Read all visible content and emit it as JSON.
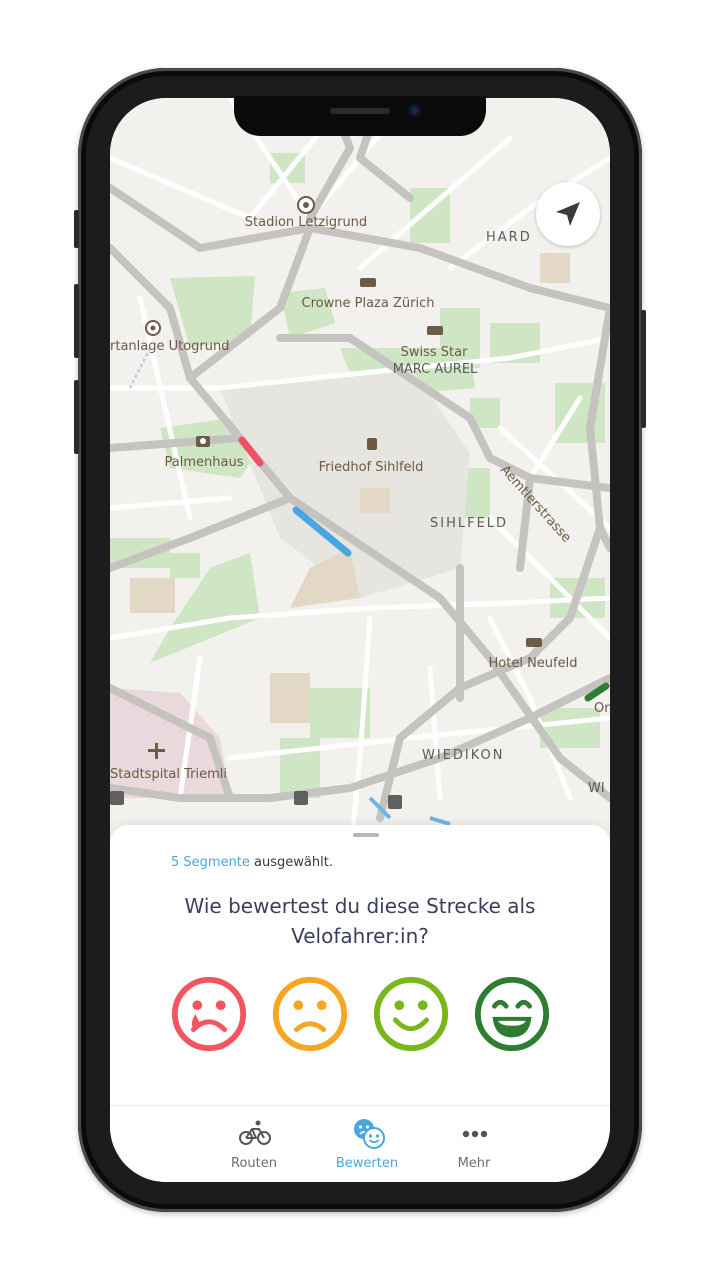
{
  "map": {
    "labels": {
      "stadion": "Stadion Letzigrund",
      "hard": "HARD",
      "crowne": "Crowne Plaza Zürich",
      "sportanlage": "rtanlage Utogrund",
      "swiss_star": "Swiss Star",
      "marc_aurel": "MARC AUREL",
      "palmenhaus": "Palmenhaus",
      "friedhof": "Friedhof Sihlfeld",
      "aemtlerstrasse": "Aemtlerstrasse",
      "sihlfeld": "SIHLFELD",
      "hotel_neufeld": "Hotel Neufeld",
      "wiedikon": "WIEDIKON",
      "stadtspital": "Stadtspital Triemli",
      "edge_or": "Or",
      "edge_wi": "WI"
    },
    "segment_colors": {
      "bad": "#f0505f",
      "selected": "#4aa6e0",
      "good": "#2e7d32"
    }
  },
  "locate_button": {
    "icon": "navigation-arrow-icon"
  },
  "rating_sheet": {
    "selected_count": "5 Segmente",
    "selected_suffix": " ausgewählt.",
    "question_line1": "Wie bewertest du diese Strecke als",
    "question_line2": "Velofahrer:in?",
    "options": [
      {
        "icon": "very-unhappy-face-icon",
        "color": "#f2555f"
      },
      {
        "icon": "unhappy-face-icon",
        "color": "#f5a623"
      },
      {
        "icon": "happy-face-icon",
        "color": "#79b61b"
      },
      {
        "icon": "very-happy-face-icon",
        "color": "#2f7d32"
      }
    ]
  },
  "tabbar": {
    "tabs": [
      {
        "label": "Routen",
        "icon": "bicycle-icon",
        "active": false
      },
      {
        "label": "Bewerten",
        "icon": "rating-faces-icon",
        "active": true
      },
      {
        "label": "Mehr",
        "icon": "more-dots-icon",
        "active": false
      }
    ],
    "accent": "#4aa6e0"
  }
}
